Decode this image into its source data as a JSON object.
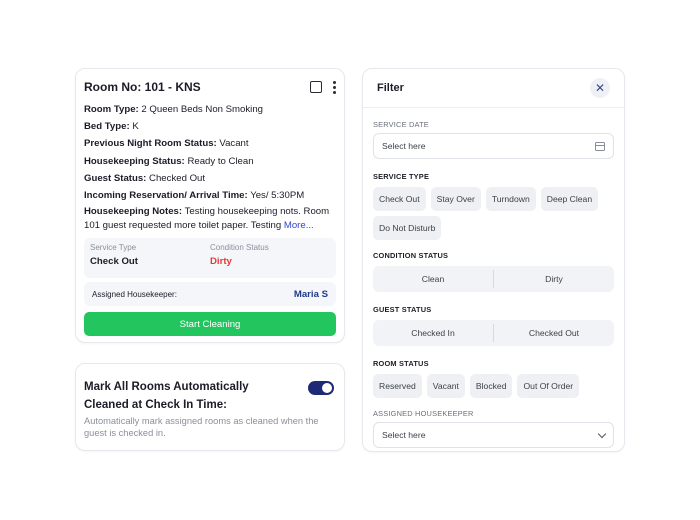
{
  "room": {
    "title": "Room No: 101 - KNS",
    "room_type_label": "Room Type:",
    "room_type_value": "2 Queen Beds Non Smoking",
    "bed_type_label": "Bed Type:",
    "bed_type_value": "K",
    "prev_status_label": "Previous Night Room Status:",
    "prev_status_value": "Vacant",
    "hk_status_label": "Housekeeping Status:",
    "hk_status_value": "Ready to Clean",
    "guest_status_label": "Guest Status:",
    "guest_status_value": "Checked Out",
    "incoming_label": "Incoming Reservation/ Arrival Time:",
    "incoming_value": "Yes/ 5:30PM",
    "notes_label": "Housekeeping Notes:",
    "notes_value": "Testing housekeeping nots. Room 101 guest requested more toilet paper. Testing",
    "more_link": "More...",
    "service_type_caption": "Service Type",
    "service_type_value": "Check Out",
    "condition_caption": "Condition Status",
    "condition_value": "Dirty",
    "assigned_label": "Assigned Housekeeper:",
    "assigned_name": "Maria S",
    "start_button": "Start Cleaning"
  },
  "auto_clean": {
    "title": "Mark All Rooms Automatically Cleaned at Check In Time:",
    "description": "Automatically mark assigned rooms as cleaned when the guest is checked in.",
    "toggle_on": true
  },
  "filter": {
    "title": "Filter",
    "close_icon": "close-icon",
    "service_date_caption": "SERVICE DATE",
    "service_date_placeholder": "Select here",
    "service_type_caption": "SERVICE TYPE",
    "service_types": [
      "Check Out",
      "Stay Over",
      "Turndown",
      "Deep Clean",
      "Do Not Disturb"
    ],
    "condition_caption": "CONDITION STATUS",
    "condition_options": [
      "Clean",
      "Dirty"
    ],
    "guest_caption": "GUEST STATUS",
    "guest_options": [
      "Checked In",
      "Checked Out"
    ],
    "room_status_caption": "ROOM STATUS",
    "room_statuses": [
      "Reserved",
      "Vacant",
      "Blocked",
      "Out Of Order"
    ],
    "housekeeper_caption": "ASSIGNED HOUSEKEEPER",
    "housekeeper_placeholder": "Select here"
  },
  "colors": {
    "accent_green": "#22c55e",
    "dirty_red": "#e53935",
    "toggle_navy": "#1e2a78",
    "link_blue": "#2f46c8"
  }
}
